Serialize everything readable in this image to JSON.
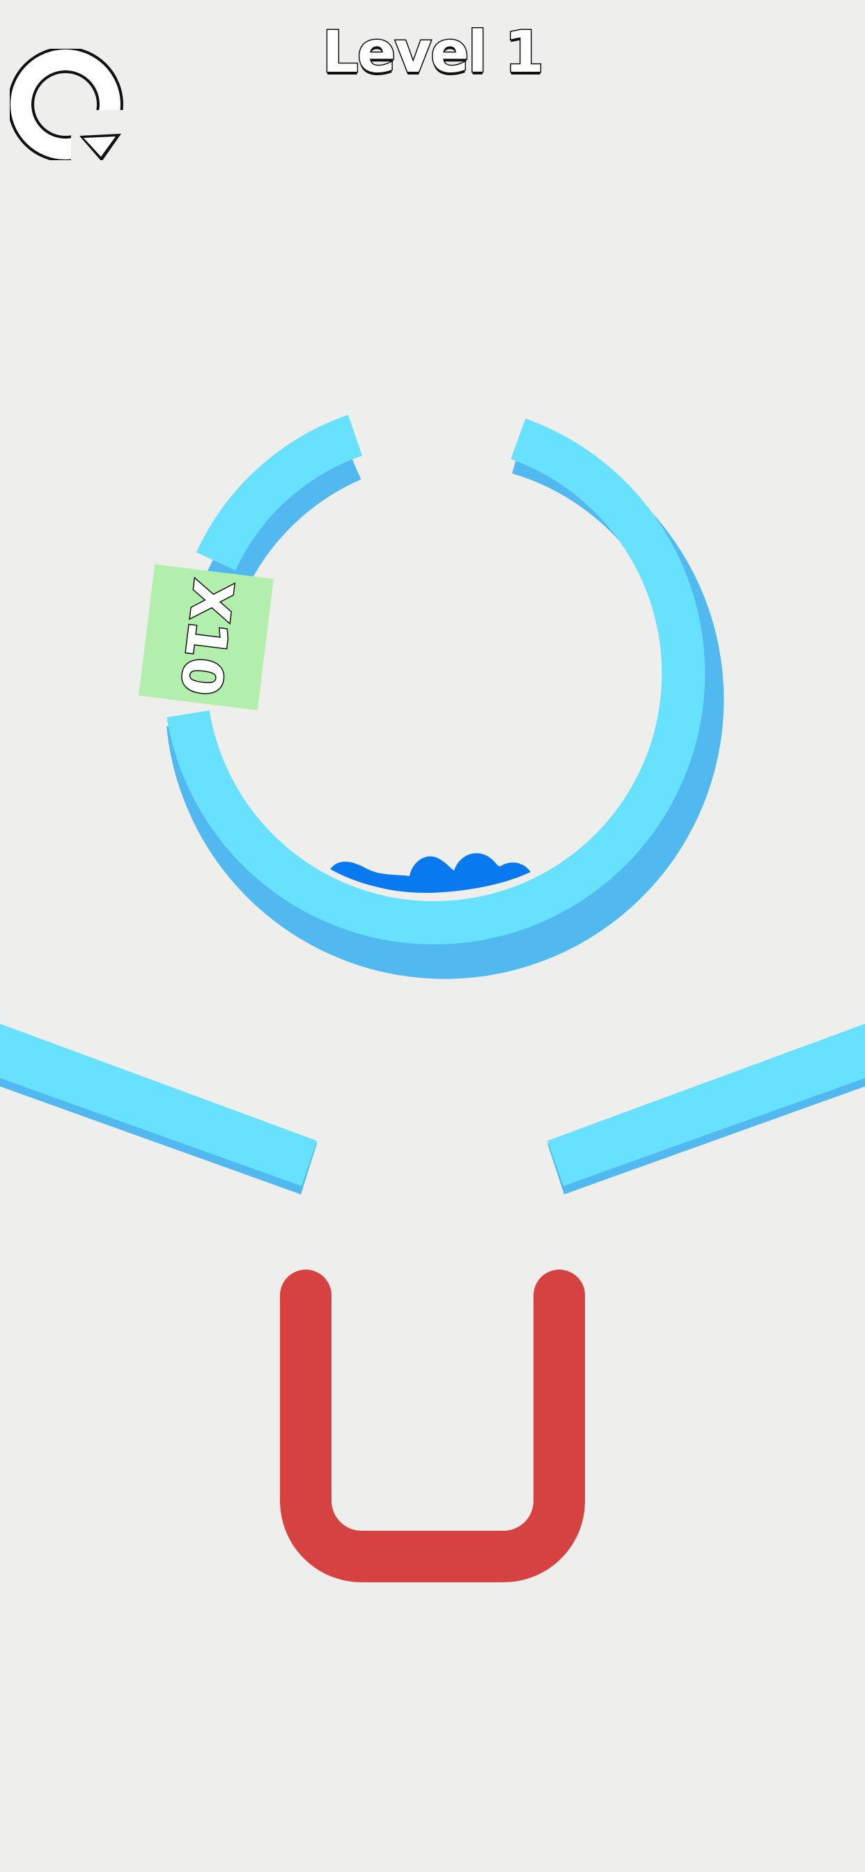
{
  "header": {
    "title": "Level 1"
  },
  "controls": {
    "restart_icon": "restart-icon"
  },
  "multiplier": {
    "label": "X10",
    "value": 10
  },
  "colors": {
    "background": "#eeefec",
    "ring_top": "#68e1fe",
    "ring_side": "#52b9f0",
    "water": "#0879ef",
    "cup": "#d64242",
    "multiplier_bg": "#b2efad",
    "title_fill": "#ffffff",
    "title_outline": "#111111"
  }
}
